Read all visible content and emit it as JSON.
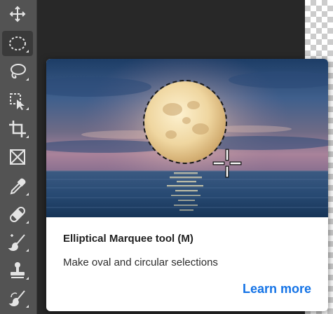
{
  "toolbar": {
    "tools": [
      {
        "name": "move-tool",
        "icon": "move-icon"
      },
      {
        "name": "elliptical-marquee-tool",
        "icon": "elliptical-marquee-icon",
        "selected": true
      },
      {
        "name": "lasso-tool",
        "icon": "lasso-icon"
      },
      {
        "name": "object-selection-tool",
        "icon": "object-selection-icon"
      },
      {
        "name": "crop-tool",
        "icon": "crop-icon"
      },
      {
        "name": "frame-tool",
        "icon": "frame-icon"
      },
      {
        "name": "eyedropper-tool",
        "icon": "eyedropper-icon"
      },
      {
        "name": "spot-healing-tool",
        "icon": "bandage-icon"
      },
      {
        "name": "brush-tool",
        "icon": "brush-icon"
      },
      {
        "name": "clone-stamp-tool",
        "icon": "stamp-icon"
      },
      {
        "name": "history-brush-tool",
        "icon": "history-brush-icon"
      }
    ]
  },
  "tooltip": {
    "title": "Elliptical Marquee tool (M)",
    "description": "Make oval and circular selections",
    "link_label": "Learn more"
  },
  "colors": {
    "toolbar_bg": "#535353",
    "canvas_bg": "#282828",
    "link": "#1473e6",
    "icon": "#e4e4e4"
  }
}
